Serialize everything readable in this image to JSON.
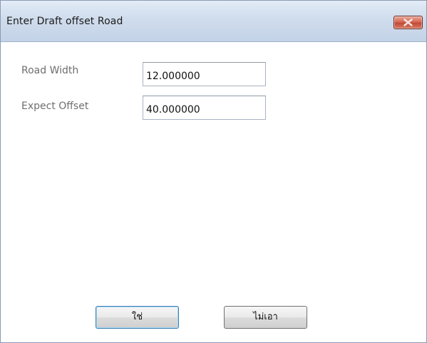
{
  "window": {
    "title": "Enter Draft offset Road"
  },
  "form": {
    "road_width_label": "Road Width",
    "road_width_value": "12.000000",
    "expect_offset_label": "Expect Offset",
    "expect_offset_value": "40.000000"
  },
  "buttons": {
    "ok_label": "ใช่",
    "cancel_label": "ไม่เอา"
  },
  "colors": {
    "close_button": "#c24a36",
    "title_bar": "#cfdcec",
    "default_button_border": "#3c7fb1"
  },
  "icons": {
    "close": "close-icon"
  }
}
